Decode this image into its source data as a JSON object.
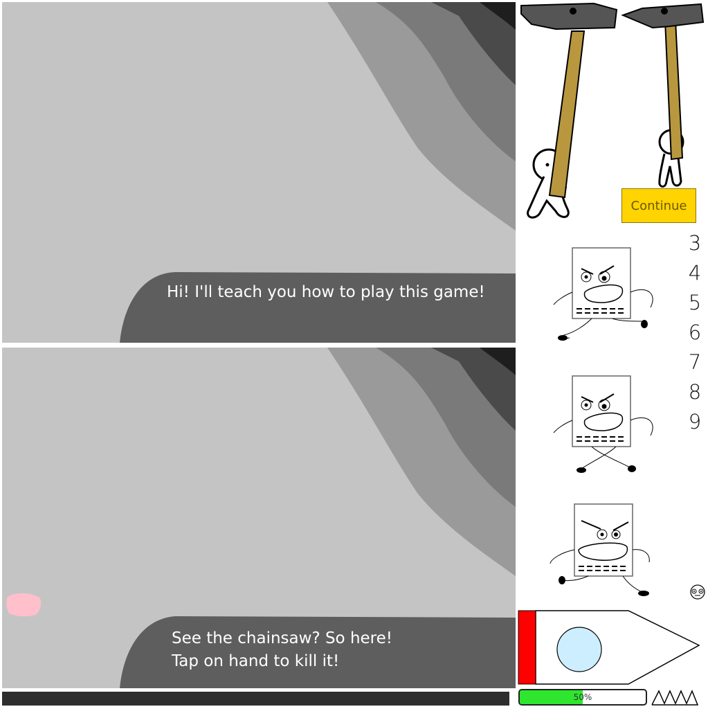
{
  "tutorial": {
    "top_message": "Hi! I'll teach you how to play this game!",
    "bottom_message_line1": "See the chainsaw? So here!",
    "bottom_message_line2": "Tap on hand to kill it!"
  },
  "sprites": {
    "continue_label": "Continue",
    "frame_numbers": [
      "3",
      "4",
      "5",
      "6",
      "7",
      "8",
      "9"
    ]
  },
  "hud": {
    "progress_label": "50%",
    "progress_value": 0.5
  },
  "colors": {
    "scene_bg": "#c4c4c4",
    "bubble": "#5e5e5e",
    "continue_bg": "#ffd400",
    "progress_fill": "#2ee62e",
    "health_red": "#ff0000",
    "target_circle": "#cdeeff",
    "hand_pink": "#ffbfcb",
    "hammer_handle": "#b8973f",
    "hammer_head": "#555555"
  }
}
